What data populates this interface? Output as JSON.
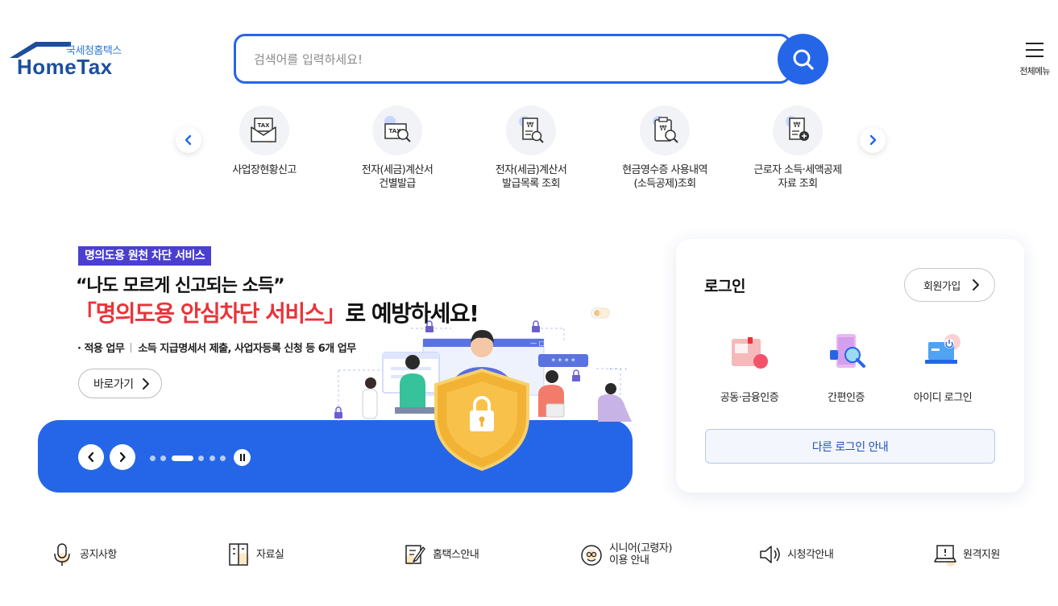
{
  "header": {
    "logo_sub": "국세청홈택스",
    "logo_main": "HomeTax",
    "search_placeholder": "검색어를 입력하세요!",
    "all_menu_label": "전체메뉴"
  },
  "quick_services": [
    {
      "label": "사업장현황신고",
      "icon": "tax-envelope-icon"
    },
    {
      "label": "전자(세금)계산서\n건별발급",
      "icon": "tax-invoice-search-icon"
    },
    {
      "label": "전자(세금)계산서\n발급목록 조회",
      "icon": "won-document-search-icon"
    },
    {
      "label": "현금영수증 사용내역\n(소득공제)조회",
      "icon": "receipt-search-icon"
    },
    {
      "label": "근로자 소득·세액공제\n자료 조회",
      "icon": "won-document-add-icon"
    }
  ],
  "banner": {
    "badge": "명의도용 원천 차단 서비스",
    "quote": "“나도 모르게 신고되는 소득”",
    "headline_red": "「명의도용 안심차단 서비스」",
    "headline_rest": "로 예방하세요!",
    "detail_label": "· 적용 업무",
    "detail_text": "소득 지급명세서 제출, 사업자등록 신청 등 6개 업무",
    "go_button": "바로가기",
    "slide_count": 6,
    "active_slide": 3
  },
  "login": {
    "title": "로그인",
    "signup_button": "회원가입",
    "options": [
      {
        "label": "공동·금융인증",
        "icon": "certificate-card-icon"
      },
      {
        "label": "간편인증",
        "icon": "phone-search-icon"
      },
      {
        "label": "아이디 로그인",
        "icon": "laptop-power-icon"
      }
    ],
    "other_login_button": "다른 로그인 안내"
  },
  "bottom_links": [
    {
      "label": "공지사항",
      "icon": "microphone-icon"
    },
    {
      "label": "자료실",
      "icon": "cabinet-icon"
    },
    {
      "label": "홈택스안내",
      "icon": "document-pen-icon"
    },
    {
      "label": "시니어(고령자)\n이용 안내",
      "icon": "senior-icon"
    },
    {
      "label": "시청각안내",
      "icon": "speaker-icon"
    },
    {
      "label": "원격지원",
      "icon": "remote-laptop-icon"
    }
  ],
  "colors": {
    "brand_blue": "#2566e8",
    "logo_navy": "#1d4e9e",
    "badge_purple": "#4a3fcf",
    "headline_red": "#e8343a",
    "text_dark": "#222222"
  }
}
